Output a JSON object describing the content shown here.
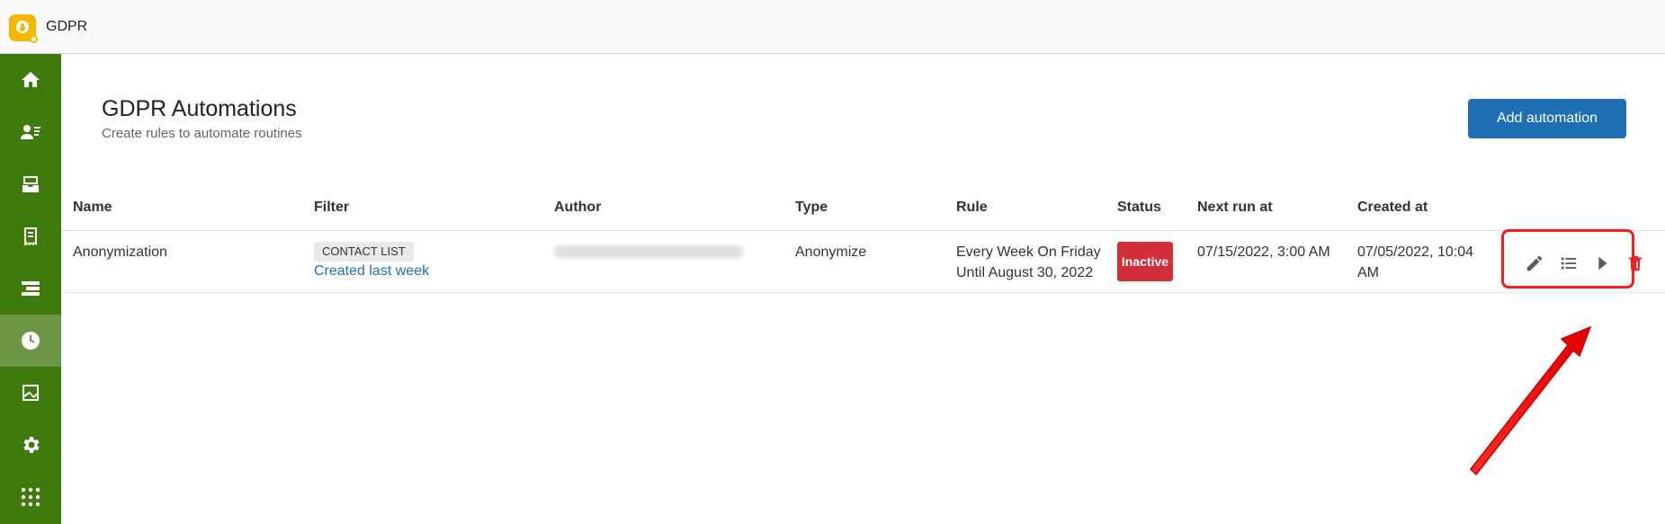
{
  "app": {
    "title": "GDPR"
  },
  "sidebar": {
    "items": [
      {
        "icon": "home-icon"
      },
      {
        "icon": "contacts-icon"
      },
      {
        "icon": "inbox-icon"
      },
      {
        "icon": "receipt-icon"
      },
      {
        "icon": "timeline-icon"
      },
      {
        "icon": "clock-icon",
        "active": true
      },
      {
        "icon": "chart-icon"
      },
      {
        "icon": "gear-icon"
      },
      {
        "icon": "apps-grid-icon"
      }
    ]
  },
  "page": {
    "title": "GDPR Automations",
    "subtitle": "Create rules to automate routines",
    "add_button": "Add automation"
  },
  "table": {
    "columns": [
      "Name",
      "Filter",
      "Author",
      "Type",
      "Rule",
      "Status",
      "Next run at",
      "Created at"
    ],
    "rows": [
      {
        "name": "Anonymization",
        "filter_chip": "CONTACT LIST",
        "filter_link": "Created last week",
        "type": "Anonymize",
        "rule_line1": "Every Week On Friday",
        "rule_line2": "Until August 30, 2022",
        "status": "Inactive",
        "next_run": "07/15/2022, 3:00 AM",
        "created_line1": "07/05/2022, 10:04",
        "created_line2": "AM"
      }
    ],
    "actions": [
      "edit-icon",
      "list-icon",
      "play-icon",
      "delete-icon"
    ]
  },
  "colors": {
    "sidebar": "#3f7a0d",
    "primary": "#1f6fb5",
    "danger": "#d32f3b",
    "highlight": "#ff1a1a"
  }
}
